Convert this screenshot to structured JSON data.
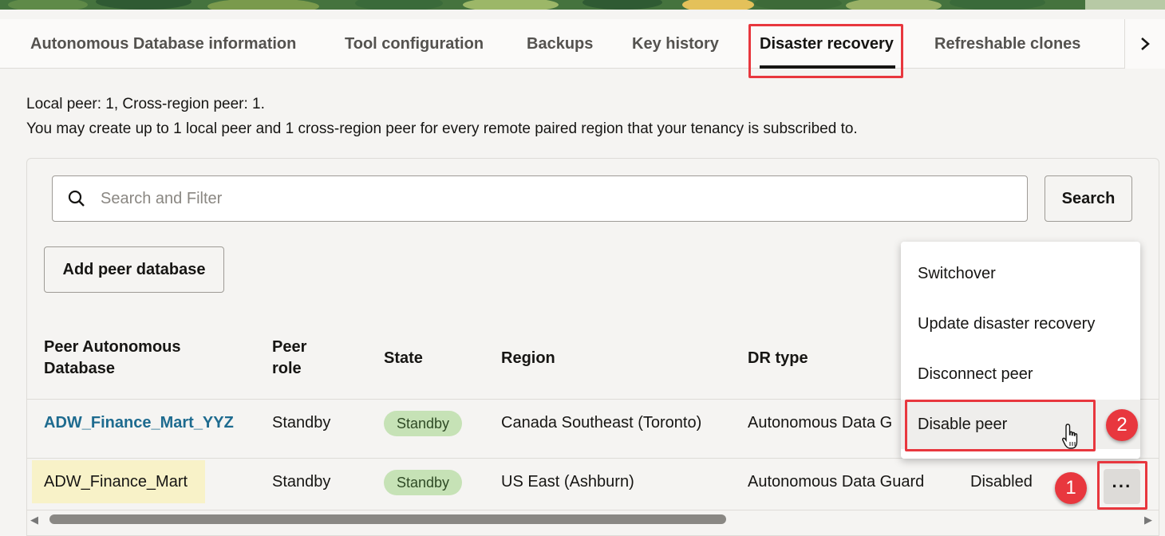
{
  "tabs": [
    {
      "label": "Autonomous Database information"
    },
    {
      "label": "Tool configuration"
    },
    {
      "label": "Backups"
    },
    {
      "label": "Key history"
    },
    {
      "label": "Disaster recovery"
    },
    {
      "label": "Refreshable clones"
    }
  ],
  "tabs_more_icon": "chevron-right-icon",
  "active_tab": "Disaster recovery",
  "info": {
    "line1": "Local peer: 1, Cross-region peer: 1.",
    "line2": "You may create up to 1 local peer and 1 cross-region peer for every remote paired region that your tenancy is subscribed to."
  },
  "search": {
    "placeholder": "Search and Filter",
    "value": "",
    "button": "Search"
  },
  "add_button": "Add peer database",
  "table": {
    "headers": [
      "Peer Autonomous Database",
      "Peer role",
      "State",
      "Region",
      "DR type"
    ],
    "rows": [
      {
        "name": "ADW_Finance_Mart_YYZ",
        "role": "Standby",
        "state": "Standby",
        "region": "Canada Southeast (Toronto)",
        "dr_type": "Autonomous Data G",
        "status": ""
      },
      {
        "name": "ADW_Finance_Mart",
        "role": "Standby",
        "state": "Standby",
        "region": "US East (Ashburn)",
        "dr_type": "Autonomous Data Guard",
        "status": "Disabled"
      }
    ]
  },
  "actions_menu": {
    "items": [
      "Switchover",
      "Update disaster recovery",
      "Disconnect peer",
      "Disable peer"
    ],
    "highlighted": "Disable peer"
  },
  "kebab_label": "···",
  "callouts": [
    "1",
    "2"
  ],
  "colors": {
    "accent_red": "#e8373e",
    "link": "#1e6b8f",
    "badge_bg": "#c6e2b6",
    "highlight_cell": "#f8f2c8"
  }
}
